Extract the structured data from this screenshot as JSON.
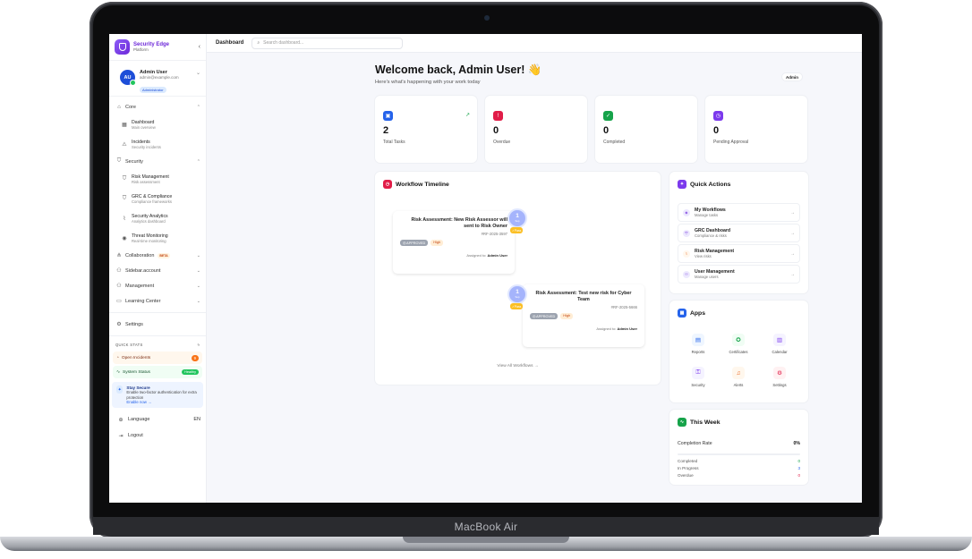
{
  "device": {
    "brand": "MacBook Air"
  },
  "sidebar": {
    "brand_title": "Security Edge",
    "brand_sub": "Platform",
    "user": {
      "initials": "AU",
      "name": "Admin User",
      "email": "admin@example.com",
      "role": "Administrator"
    },
    "groups": {
      "core": "Core",
      "security": "Security",
      "collaboration": "Collaboration",
      "collab_badge": "BETA",
      "account": "Sidebar.account",
      "management": "Management",
      "learning": "Learning Center"
    },
    "core_items": [
      {
        "title": "Dashboard",
        "sub": "Main overview",
        "icon": "grid-icon"
      },
      {
        "title": "Incidents",
        "sub": "Security incidents",
        "icon": "warning-icon"
      }
    ],
    "security_items": [
      {
        "title": "Risk Management",
        "sub": "Risk assessment",
        "icon": "shield-icon"
      },
      {
        "title": "GRC & Compliance",
        "sub": "Compliance frameworks",
        "icon": "shield-icon"
      },
      {
        "title": "Security Analytics",
        "sub": "Analytics dashboard",
        "icon": "chart-icon"
      },
      {
        "title": "Threat Monitoring",
        "sub": "Real-time monitoring",
        "icon": "eye-icon"
      }
    ],
    "settings": "Settings",
    "quick_stats": {
      "title": "QUICK STATS",
      "open_incidents": "Open Incidents",
      "open_count": "9",
      "system_status": "System Status",
      "status_value": "Healthy"
    },
    "stay_secure": {
      "title": "Stay Secure",
      "desc": "Enable two-factor authentication for extra protection",
      "link": "Enable now →"
    },
    "language": "Language",
    "language_value": "EN",
    "logout": "Logout"
  },
  "topbar": {
    "crumb": "Dashboard",
    "search_placeholder": "Search dashboard..."
  },
  "main": {
    "welcome": "Welcome back, Admin User! 👋",
    "subtitle": "Here's what's happening with your work today",
    "badge": "Admin",
    "stats": [
      {
        "value": "2",
        "label": "Total Tasks",
        "color": "#2563eb",
        "icon": "briefcase-icon"
      },
      {
        "value": "0",
        "label": "Overdue",
        "color": "#e11d48",
        "icon": "alert-icon"
      },
      {
        "value": "0",
        "label": "Completed",
        "color": "#16a34a",
        "icon": "check-icon"
      },
      {
        "value": "0",
        "label": "Pending Approval",
        "color": "#7c3aed",
        "icon": "clock-icon"
      }
    ],
    "timeline": {
      "title": "Workflow Timeline",
      "items": [
        {
          "title": "Risk Assessment: New Risk Assessor will sent to Risk Owner",
          "id": "#RF-2025-3597",
          "status": "APPROVED",
          "priority": "High",
          "assigned_label": "Assigned to:",
          "assignee": "Admin User",
          "node_num": "1",
          "node_month": "Sep",
          "node_tag": "Pass"
        },
        {
          "title": "Risk Assessment: Test new risk for Cyber Team",
          "id": "#RF-2025-5666",
          "status": "APPROVED",
          "priority": "High",
          "assigned_label": "Assigned to:",
          "assignee": "Admin User",
          "node_num": "1",
          "node_month": "Sep",
          "node_tag": "Pass"
        }
      ],
      "view_all": "View All Workflows →"
    },
    "quick_actions": {
      "title": "Quick Actions",
      "items": [
        {
          "title": "My Workflows",
          "sub": "Manage tasks",
          "icon": "workflow-icon"
        },
        {
          "title": "GRC Dashboard",
          "sub": "Compliance & risks",
          "icon": "shield-icon"
        },
        {
          "title": "Risk Management",
          "sub": "View risks",
          "icon": "chart-icon"
        },
        {
          "title": "User Management",
          "sub": "Manage users",
          "icon": "users-icon"
        }
      ]
    },
    "apps": {
      "title": "Apps",
      "items": [
        {
          "label": "Reports",
          "icon": "document-icon",
          "color": "#2563eb",
          "bg": "#eff6ff"
        },
        {
          "label": "Certificates",
          "icon": "certificate-icon",
          "color": "#16a34a",
          "bg": "#f0fdf4"
        },
        {
          "label": "Calendar",
          "icon": "calendar-icon",
          "color": "#7c3aed",
          "bg": "#f5f3ff"
        },
        {
          "label": "Security",
          "icon": "lock-icon",
          "color": "#7c3aed",
          "bg": "#f5f3ff"
        },
        {
          "label": "Alerts",
          "icon": "bell-icon",
          "color": "#ea580c",
          "bg": "#fff7ed"
        },
        {
          "label": "Settings",
          "icon": "gear-icon",
          "color": "#e11d48",
          "bg": "#fff1f2"
        }
      ]
    },
    "this_week": {
      "title": "This Week",
      "rate_label": "Completion Rate",
      "rate_value": "0%",
      "rate_fraction": 0,
      "rows": [
        {
          "label": "Completed",
          "value": "0",
          "color": "#16a34a"
        },
        {
          "label": "In Progress",
          "value": "3",
          "color": "#2563eb"
        },
        {
          "label": "Overdue",
          "value": "0",
          "color": "#e11d48"
        }
      ]
    }
  }
}
